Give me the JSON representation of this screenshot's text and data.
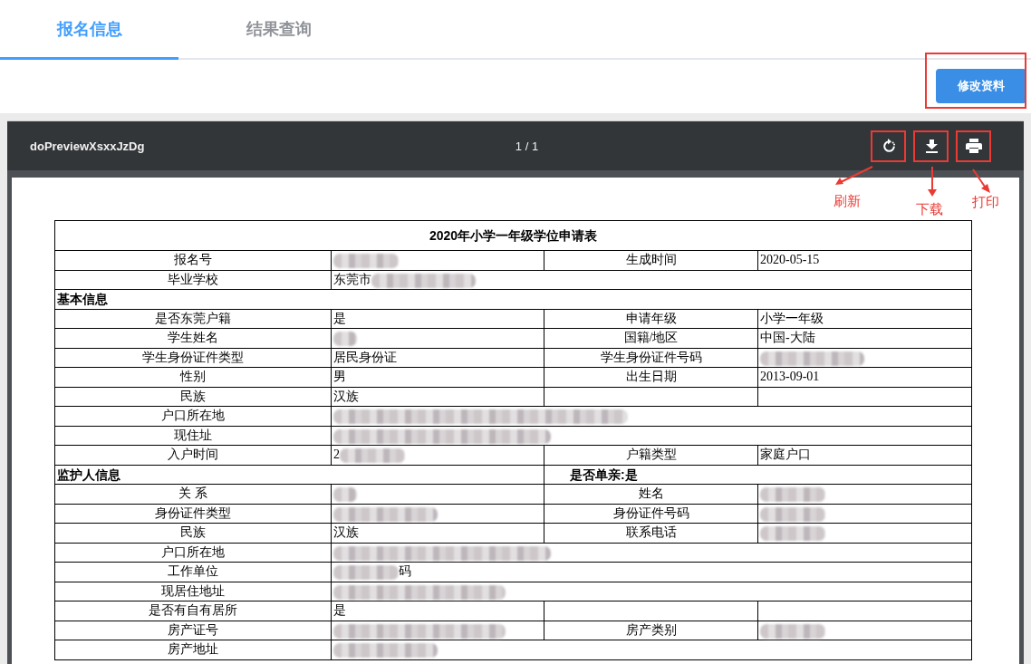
{
  "tabs": [
    {
      "label": "报名信息",
      "selected": true
    },
    {
      "label": "结果查询",
      "selected": false
    }
  ],
  "edit_button": {
    "label": "修改资料",
    "highlighted": true
  },
  "viewer": {
    "title": "doPreviewXsxxJzDg",
    "page_indicator": "1 / 1",
    "tools": [
      {
        "kind": "refresh",
        "highlighted": true,
        "callout": {
          "kind": "left",
          "label": "刷新"
        }
      },
      {
        "kind": "download",
        "highlighted": true,
        "callout": {
          "kind": "down",
          "label": "下载"
        }
      },
      {
        "kind": "print",
        "highlighted": true,
        "callout": {
          "kind": "right",
          "label": "打印"
        }
      }
    ]
  },
  "document": {
    "title": "2020年小学一年级学位申请表",
    "rows": [
      {
        "kind": "pair",
        "label": "报名号",
        "value": [
          {
            "kind": "blur-medium"
          }
        ],
        "label_2": "生成时间",
        "value_2": [
          {
            "kind": "text",
            "text": "2020-05-15"
          }
        ]
      },
      {
        "kind": "wide",
        "label": "毕业学校",
        "value": [
          {
            "kind": "text",
            "text": "东莞市"
          },
          {
            "kind": "blur-long"
          }
        ]
      },
      {
        "kind": "section",
        "text": "基本信息"
      },
      {
        "kind": "pair",
        "label": "是否东莞户籍",
        "value": [
          {
            "kind": "text",
            "text": "是"
          }
        ],
        "label_2": "申请年级",
        "value_2": [
          {
            "kind": "text",
            "text": "小学一年级"
          }
        ]
      },
      {
        "kind": "pair",
        "label": "学生姓名",
        "value": [
          {
            "kind": "blur-tiny"
          }
        ],
        "label_2": "国籍/地区",
        "value_2": [
          {
            "kind": "text",
            "text": "中国-大陆"
          }
        ]
      },
      {
        "kind": "pair",
        "label": "学生身份证件类型",
        "value": [
          {
            "kind": "text",
            "text": "居民身份证"
          }
        ],
        "label_2": "学生身份证件号码",
        "value_2": [
          {
            "kind": "blur-long"
          }
        ]
      },
      {
        "kind": "pair",
        "label": "性别",
        "value": [
          {
            "kind": "text",
            "text": "男"
          }
        ],
        "label_2": "出生日期",
        "value_2": [
          {
            "kind": "text",
            "text": "2013-09-01"
          }
        ]
      },
      {
        "kind": "pair",
        "label": "民族",
        "value": [
          {
            "kind": "text",
            "text": "汉族"
          }
        ]
      },
      {
        "kind": "wide",
        "label": "户口所在地",
        "value": [
          {
            "kind": "blur-huge"
          }
        ]
      },
      {
        "kind": "wide",
        "label": "现住址",
        "value": [
          {
            "kind": "blur-wide"
          }
        ]
      },
      {
        "kind": "pair",
        "label": "入户时间",
        "value": [
          {
            "kind": "text",
            "text": "2"
          },
          {
            "kind": "blur-medium"
          }
        ],
        "label_2": "户籍类型",
        "value_2": [
          {
            "kind": "text",
            "text": "家庭户口"
          }
        ]
      },
      {
        "kind": "section",
        "text": "监护人信息",
        "aside": "是否单亲:是"
      },
      {
        "kind": "pair",
        "label": "关 系",
        "value": [
          {
            "kind": "blur-tiny"
          }
        ],
        "label_2": "姓名",
        "value_2": [
          {
            "kind": "blur-medium"
          }
        ]
      },
      {
        "kind": "pair",
        "label": "身份证件类型",
        "value": [
          {
            "kind": "blur-long"
          }
        ],
        "label_2": "身份证件号码",
        "value_2": [
          {
            "kind": "blur-medium"
          }
        ]
      },
      {
        "kind": "pair",
        "label": "民族",
        "value": [
          {
            "kind": "text",
            "text": "汉族"
          }
        ],
        "label_2": "联系电话",
        "value_2": [
          {
            "kind": "blur-medium"
          }
        ]
      },
      {
        "kind": "wide",
        "label": "户口所在地",
        "value": [
          {
            "kind": "blur-wide"
          }
        ]
      },
      {
        "kind": "wide",
        "label": "工作单位",
        "value": [
          {
            "kind": "blur-medium"
          },
          {
            "kind": "text",
            "text": "码"
          }
        ]
      },
      {
        "kind": "wide",
        "label": "现居住地址",
        "value": [
          {
            "kind": "blur-longer"
          }
        ]
      },
      {
        "kind": "pair",
        "label": "是否有自有居所",
        "value": [
          {
            "kind": "text",
            "text": "是"
          }
        ]
      },
      {
        "kind": "pair",
        "label": "房产证号",
        "value": [
          {
            "kind": "blur-longer"
          }
        ],
        "label_2": "房产类别",
        "value_2": [
          {
            "kind": "blur-medium"
          }
        ]
      },
      {
        "kind": "wide",
        "label": "房产地址",
        "value": [
          {
            "kind": "blur-long"
          }
        ]
      }
    ]
  }
}
